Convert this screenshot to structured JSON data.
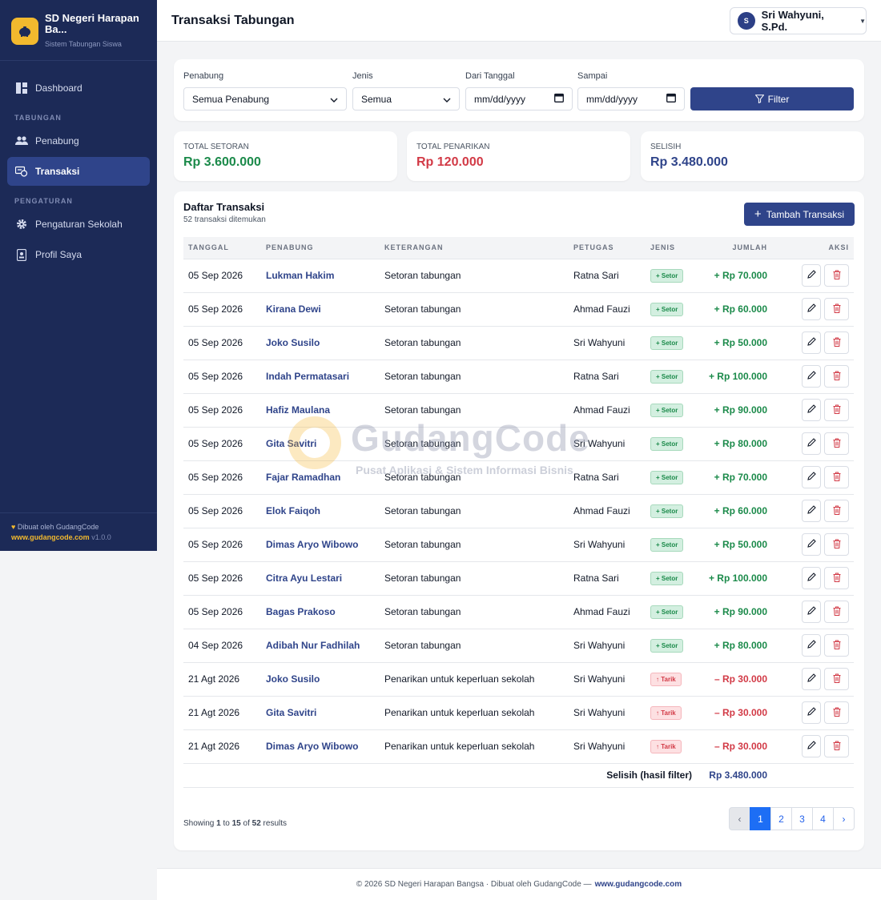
{
  "brand": {
    "name": "SD Negeri Harapan Ba...",
    "subtitle": "Sistem Tabungan Siswa"
  },
  "nav": {
    "dashboard": "Dashboard",
    "section_tabungan": "TABUNGAN",
    "penabung": "Penabung",
    "transaksi": "Transaksi",
    "section_pengaturan": "PENGATURAN",
    "pengaturan_sekolah": "Pengaturan Sekolah",
    "profil": "Profil Saya"
  },
  "sidebar_footer": {
    "made_by": "Dibuat oleh GudangCode",
    "site": "www.gudangcode.com",
    "version": "v1.0.0"
  },
  "header": {
    "title": "Transaksi Tabungan",
    "user_initial": "S",
    "user_name": "Sri Wahyuni, S.Pd."
  },
  "filter": {
    "penabung_label": "Penabung",
    "penabung_value": "Semua Penabung",
    "jenis_label": "Jenis",
    "jenis_value": "Semua",
    "dari_label": "Dari Tanggal",
    "dari_value": "mm/dd/yyyy",
    "sampai_label": "Sampai",
    "sampai_value": "mm/dd/yyyy",
    "button": "Filter"
  },
  "stats": {
    "setoran_label": "TOTAL SETORAN",
    "setoran_value": "Rp 3.600.000",
    "penarikan_label": "TOTAL PENARIKAN",
    "penarikan_value": "Rp 120.000",
    "selisih_label": "SELISIH",
    "selisih_value": "Rp 3.480.000"
  },
  "list": {
    "title": "Daftar Transaksi",
    "subtitle": "52 transaksi ditemukan",
    "add_button": "Tambah Transaksi",
    "columns": [
      "TANGGAL",
      "PENABUNG",
      "KETERANGAN",
      "PETUGAS",
      "JENIS",
      "JUMLAH",
      "AKSI"
    ],
    "rows": [
      {
        "date": "05 Sep 2026",
        "name": "Lukman Hakim",
        "desc": "Setoran tabungan",
        "officer": "Ratna Sari",
        "type": "setor",
        "type_label": "+ Setor",
        "amount": "+ Rp 70.000"
      },
      {
        "date": "05 Sep 2026",
        "name": "Kirana Dewi",
        "desc": "Setoran tabungan",
        "officer": "Ahmad Fauzi",
        "type": "setor",
        "type_label": "+ Setor",
        "amount": "+ Rp 60.000"
      },
      {
        "date": "05 Sep 2026",
        "name": "Joko Susilo",
        "desc": "Setoran tabungan",
        "officer": "Sri Wahyuni",
        "type": "setor",
        "type_label": "+ Setor",
        "amount": "+ Rp 50.000"
      },
      {
        "date": "05 Sep 2026",
        "name": "Indah Permatasari",
        "desc": "Setoran tabungan",
        "officer": "Ratna Sari",
        "type": "setor",
        "type_label": "+ Setor",
        "amount": "+ Rp 100.000"
      },
      {
        "date": "05 Sep 2026",
        "name": "Hafiz Maulana",
        "desc": "Setoran tabungan",
        "officer": "Ahmad Fauzi",
        "type": "setor",
        "type_label": "+ Setor",
        "amount": "+ Rp 90.000"
      },
      {
        "date": "05 Sep 2026",
        "name": "Gita Savitri",
        "desc": "Setoran tabungan",
        "officer": "Sri Wahyuni",
        "type": "setor",
        "type_label": "+ Setor",
        "amount": "+ Rp 80.000"
      },
      {
        "date": "05 Sep 2026",
        "name": "Fajar Ramadhan",
        "desc": "Setoran tabungan",
        "officer": "Ratna Sari",
        "type": "setor",
        "type_label": "+ Setor",
        "amount": "+ Rp 70.000"
      },
      {
        "date": "05 Sep 2026",
        "name": "Elok Faiqoh",
        "desc": "Setoran tabungan",
        "officer": "Ahmad Fauzi",
        "type": "setor",
        "type_label": "+ Setor",
        "amount": "+ Rp 60.000"
      },
      {
        "date": "05 Sep 2026",
        "name": "Dimas Aryo Wibowo",
        "desc": "Setoran tabungan",
        "officer": "Sri Wahyuni",
        "type": "setor",
        "type_label": "+ Setor",
        "amount": "+ Rp 50.000"
      },
      {
        "date": "05 Sep 2026",
        "name": "Citra Ayu Lestari",
        "desc": "Setoran tabungan",
        "officer": "Ratna Sari",
        "type": "setor",
        "type_label": "+ Setor",
        "amount": "+ Rp 100.000"
      },
      {
        "date": "05 Sep 2026",
        "name": "Bagas Prakoso",
        "desc": "Setoran tabungan",
        "officer": "Ahmad Fauzi",
        "type": "setor",
        "type_label": "+ Setor",
        "amount": "+ Rp 90.000"
      },
      {
        "date": "04 Sep 2026",
        "name": "Adibah Nur Fadhilah",
        "desc": "Setoran tabungan",
        "officer": "Sri Wahyuni",
        "type": "setor",
        "type_label": "+ Setor",
        "amount": "+ Rp 80.000"
      },
      {
        "date": "21 Agt 2026",
        "name": "Joko Susilo",
        "desc": "Penarikan untuk keperluan sekolah",
        "officer": "Sri Wahyuni",
        "type": "tarik",
        "type_label": "↑ Tarik",
        "amount": "– Rp 30.000"
      },
      {
        "date": "21 Agt 2026",
        "name": "Gita Savitri",
        "desc": "Penarikan untuk keperluan sekolah",
        "officer": "Sri Wahyuni",
        "type": "tarik",
        "type_label": "↑ Tarik",
        "amount": "– Rp 30.000"
      },
      {
        "date": "21 Agt 2026",
        "name": "Dimas Aryo Wibowo",
        "desc": "Penarikan untuk keperluan sekolah",
        "officer": "Sri Wahyuni",
        "type": "tarik",
        "type_label": "↑ Tarik",
        "amount": "– Rp 30.000"
      }
    ],
    "summary_label": "Selisih (hasil filter)",
    "summary_value": "Rp 3.480.000",
    "showing": {
      "prefix": "Showing",
      "from": "1",
      "to_word": "to",
      "to": "15",
      "of_word": "of",
      "total": "52",
      "suffix": "results"
    },
    "pages": [
      "‹",
      "1",
      "2",
      "3",
      "4",
      "›"
    ]
  },
  "watermark": {
    "title": "GudangCode",
    "subtitle": "Pusat Aplikasi & Sistem Informasi Bisnis"
  },
  "footer": {
    "text": "© 2026 SD Negeri Harapan Bangsa · Dibuat oleh GudangCode —",
    "link": "www.gudangcode.com"
  },
  "colors": {
    "sidebar": "#1c2a57",
    "accent": "#2f448a",
    "positive": "#1b8a4a",
    "negative": "#d23a46",
    "brand_yellow": "#f2b92e"
  }
}
